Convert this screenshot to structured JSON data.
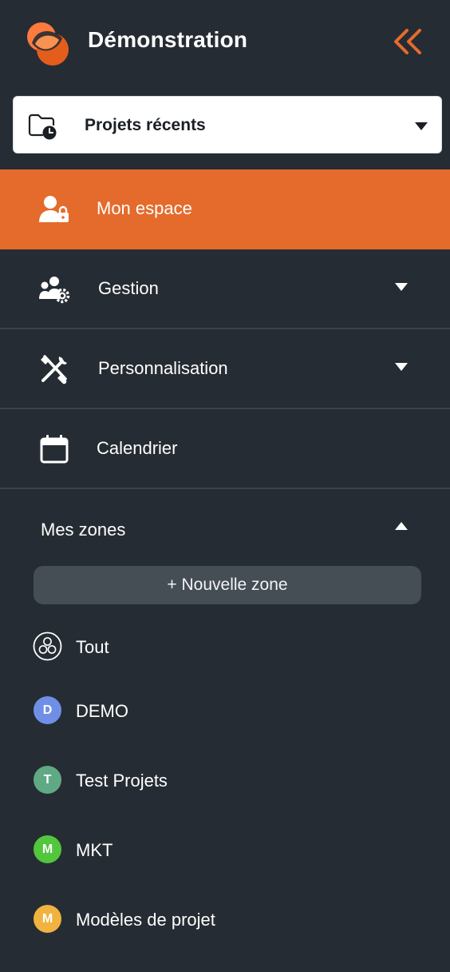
{
  "app": {
    "title": "Démonstration"
  },
  "icons": {
    "logo": "app-logo",
    "collapse": "double-chevron-left-icon",
    "recent": "folder-clock-icon",
    "my_space": "user-lock-icon",
    "management": "users-gear-icon",
    "customization": "tools-icon",
    "calendar": "calendar-icon",
    "all_zones": "circles-icon"
  },
  "colors": {
    "background": "#262c33",
    "accent": "#e46b2c",
    "divider": "#3b434c",
    "new_zone_button": "#454d55"
  },
  "recent_projects": {
    "label": "Projets récents"
  },
  "nav": {
    "my_space": "Mon espace",
    "management": "Gestion",
    "customization": "Personnalisation",
    "calendar": "Calendrier"
  },
  "zones": {
    "title": "Mes zones",
    "new_zone_label": "+ Nouvelle zone",
    "all_label": "Tout",
    "items": [
      {
        "initial": "D",
        "name": "DEMO",
        "color": "#6f8fe6"
      },
      {
        "initial": "T",
        "name": "Test Projets",
        "color": "#5faa85"
      },
      {
        "initial": "M",
        "name": "MKT",
        "color": "#52c63d"
      },
      {
        "initial": "M",
        "name": "Modèles de projet",
        "color": "#f0b33f"
      }
    ]
  }
}
